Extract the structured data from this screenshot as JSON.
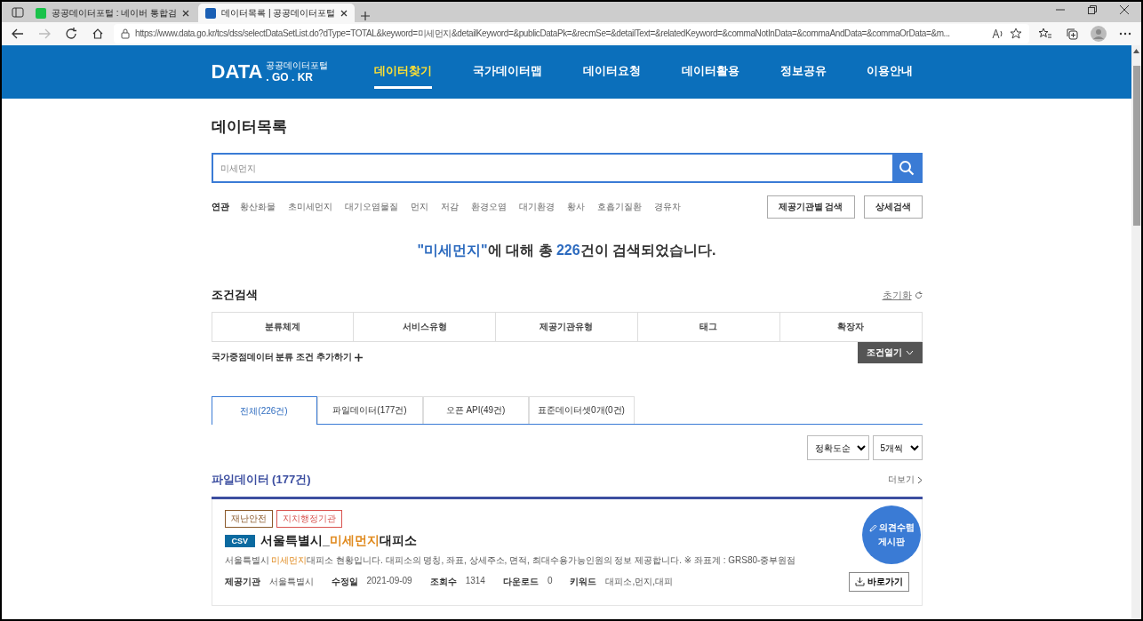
{
  "browser": {
    "tabs": [
      {
        "title": "공공데이터포털 : 네이버 통합검",
        "selected": false
      },
      {
        "title": "데이터목록 | 공공데이터포털",
        "selected": true
      }
    ],
    "address": "https://www.data.go.kr/tcs/dss/selectDataSetList.do?dType=TOTAL&keyword=미세먼지&detailKeyword=&publicDataPk=&recmSe=&detailText=&relatedKeyword=&commaNotInData=&commaAndData=&commaOrData=&m..."
  },
  "header": {
    "logo": {
      "main": "DATA",
      "sub": "공공데이터포털",
      "domain": ". GO . KR"
    },
    "nav": [
      {
        "label": "데이터찾기",
        "selected": true
      },
      {
        "label": "국가데이터맵",
        "selected": false
      },
      {
        "label": "데이터요청",
        "selected": false
      },
      {
        "label": "데이터활용",
        "selected": false
      },
      {
        "label": "정보공유",
        "selected": false
      },
      {
        "label": "이용안내",
        "selected": false
      }
    ]
  },
  "page_title": "데이터목록",
  "search": {
    "placeholder": "미세먼지"
  },
  "related": {
    "label": "연관",
    "keywords": [
      "황산화물",
      "초미세먼지",
      "대기오염물질",
      "먼지",
      "저감",
      "환경오염",
      "대기환경",
      "황사",
      "호흡기질환",
      "경유차"
    ]
  },
  "search_buttons": [
    "제공기관별 검색",
    "상세검색"
  ],
  "result_summary": [
    {
      "text": "\"미세먼지\"",
      "highlight": true
    },
    {
      "text": "에 대해 총 ",
      "highlight": false
    },
    {
      "text": "226",
      "highlight": true
    },
    {
      "text": "건이 검색되었습니다.",
      "highlight": false
    }
  ],
  "conditions": {
    "title": "조건검색",
    "reset": "초기화",
    "categories": [
      "분류체계",
      "서비스유형",
      "제공기관유형",
      "태그",
      "확장자"
    ],
    "add_link": "국가중점데이터 분류 조건 추가하기",
    "open_button": "조건열기"
  },
  "tabs": [
    {
      "label": "전체(226건)",
      "selected": true
    },
    {
      "label": "파일데이터(177건)",
      "selected": false
    },
    {
      "label": "오픈 API(49건)",
      "selected": false
    },
    {
      "label": "표준데이터셋0개(0건)",
      "selected": false
    }
  ],
  "sort": [
    "정확도순",
    "5개씩"
  ],
  "section": {
    "title": "파일데이터 (177건)",
    "more": "더보기",
    "items": [
      {
        "tags": [
          {
            "label": "재난안전",
            "color": "#8b5a2b"
          },
          {
            "label": "지치행정기관",
            "color": "#d9534f"
          }
        ],
        "format": "CSV",
        "title": [
          {
            "text": "서울특별시_",
            "highlight": false
          },
          {
            "text": "미세먼지",
            "highlight": true
          },
          {
            "text": "대피소",
            "highlight": false
          }
        ],
        "description": [
          {
            "text": "서울특별시 ",
            "highlight": false
          },
          {
            "text": "미세먼지",
            "highlight": true
          },
          {
            "text": "대피소 현황입니다. 대피소의 명칭, 좌표, 상세주소, 면적, 최대수용가능인원의 정보 제공합니다. ※ 좌표계 : GRS80-중부원점",
            "highlight": false
          }
        ],
        "meta": [
          {
            "label": "제공기관",
            "value": "서울특별시"
          },
          {
            "label": "수정일",
            "value": "2021-09-09"
          },
          {
            "label": "조회수",
            "value": "1314"
          },
          {
            "label": "다운로드",
            "value": "0"
          },
          {
            "label": "키워드",
            "value": "대피소,먼지,대피"
          }
        ],
        "goto": "바로가기"
      }
    ]
  },
  "feedback_button": [
    "의견수렴",
    "게시판"
  ]
}
